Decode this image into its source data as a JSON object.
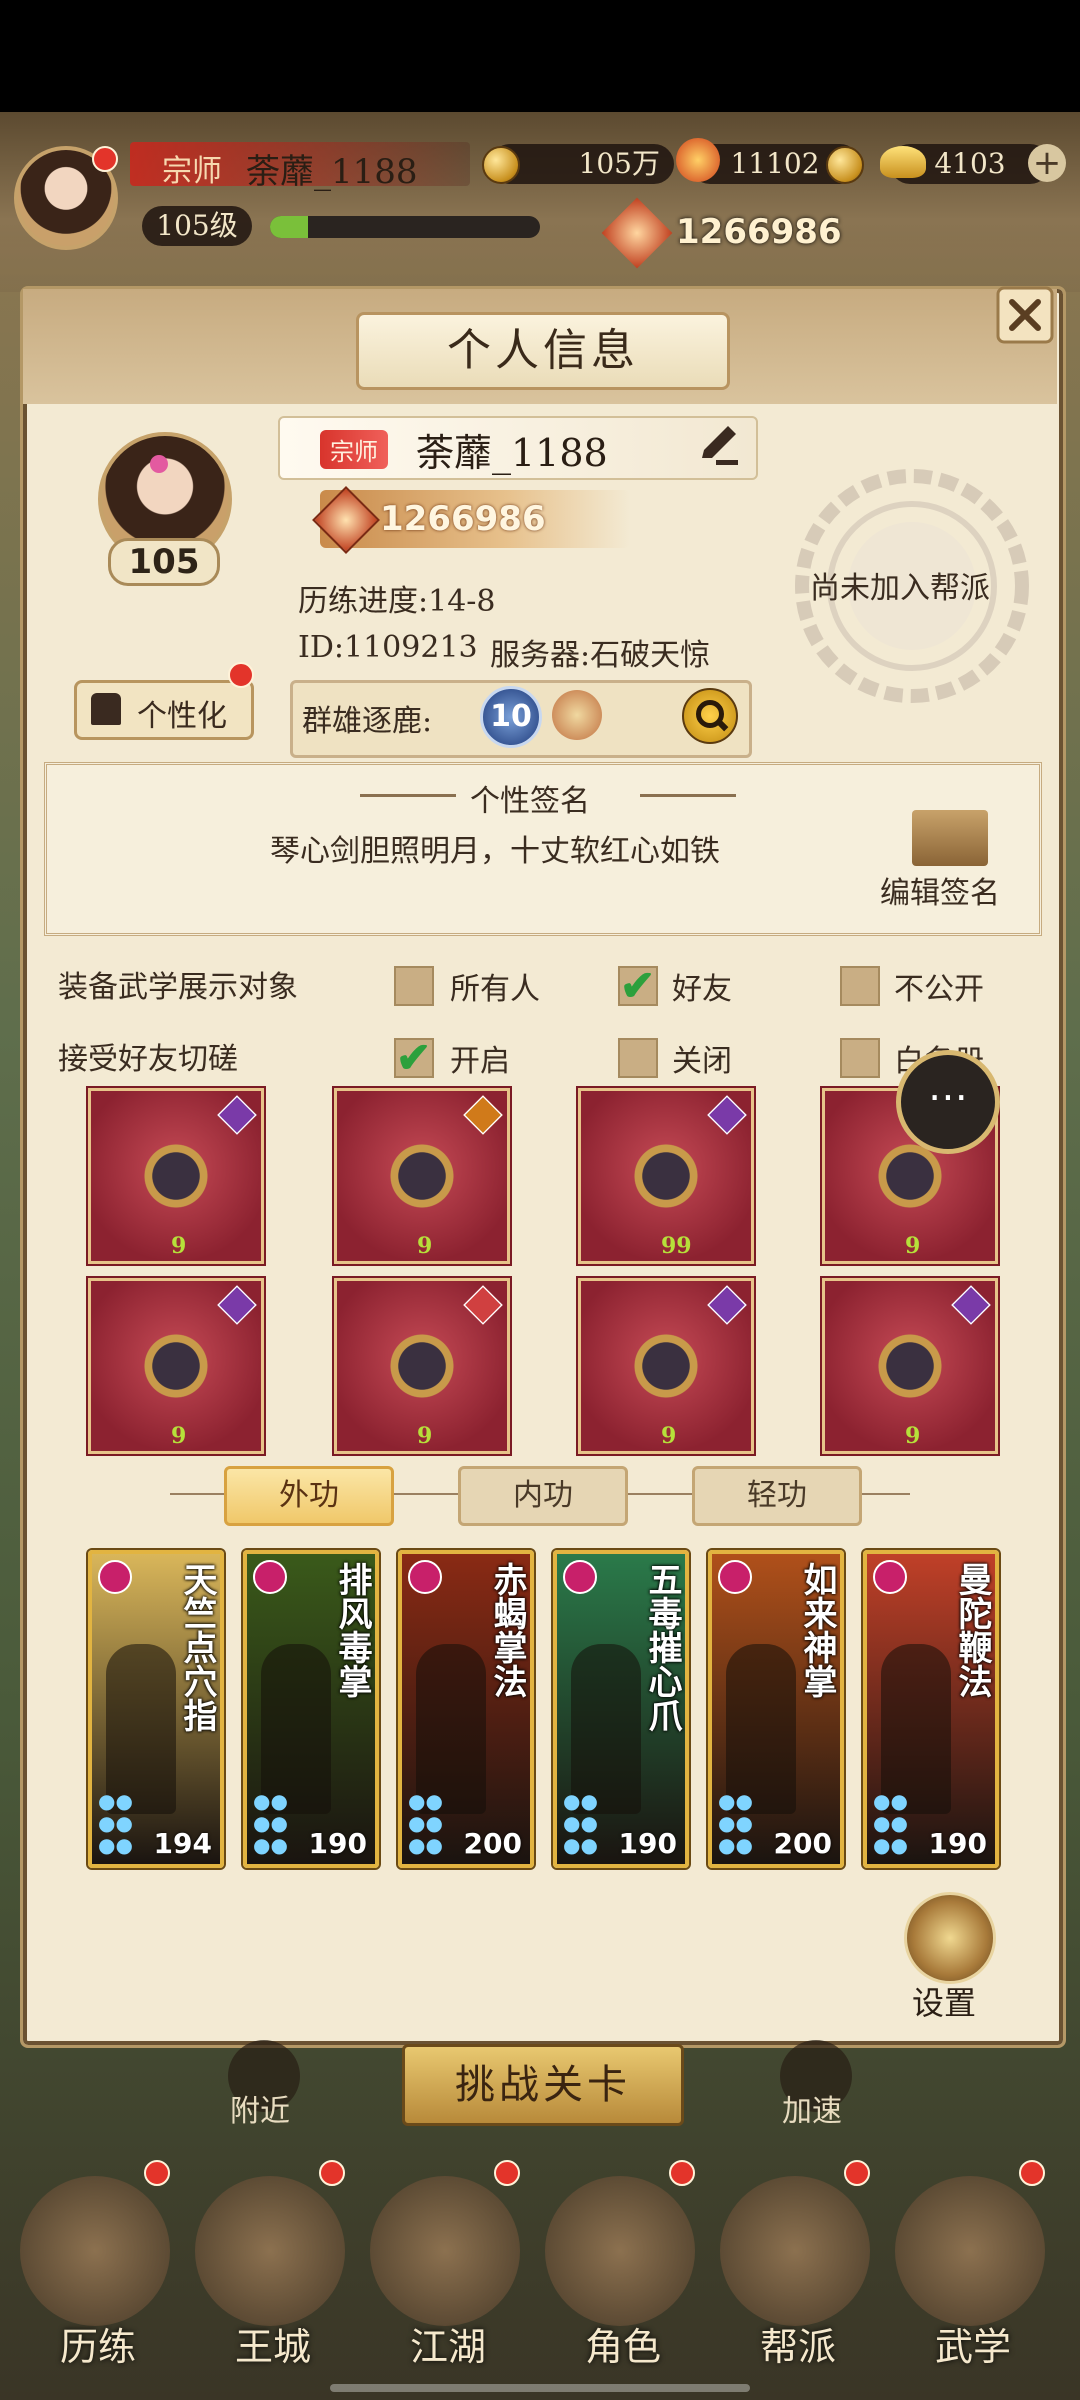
{
  "hud": {
    "title_badge": "宗师",
    "player_name": "荼蘼_1188",
    "level": "105级",
    "coins": "105万",
    "stamina": "11102",
    "ingots": "4103",
    "power": "1266986"
  },
  "panel": {
    "title": "个人信息",
    "badge": "宗师",
    "name": "荼蘼_1188",
    "power": "1266986",
    "level": "105",
    "progress": "历练进度:14-8",
    "id_line": "ID:1109213",
    "server": "服务器:石破天惊",
    "personalize": "个性化",
    "arena_label": "群雄逐鹿:",
    "arena_rank": "10",
    "guild_status": "尚未加入帮派",
    "signature_title": "个性签名",
    "signature_text": "琴心剑胆照明月，十丈软红心如铁",
    "edit_signature": "编辑签名"
  },
  "settings": {
    "equip_label": "装备武学展示对象",
    "equip_opts": [
      "所有人",
      "好友",
      "不公开"
    ],
    "equip_checked": 1,
    "spar_label": "接受好友切磋",
    "spar_opts": [
      "开启",
      "关闭",
      "白名册"
    ],
    "spar_checked": 0
  },
  "equipment": [
    {
      "name": "gauntlet",
      "lvl": "9",
      "color": "#7a3aa8"
    },
    {
      "name": "robe",
      "lvl": "9",
      "color": "#d07a1a"
    },
    {
      "name": "belt",
      "lvl": "99",
      "color": "#7a3aa8"
    },
    {
      "name": "boots",
      "lvl": "9",
      "color": "#7a3aa8"
    },
    {
      "name": "necklace",
      "lvl": "9",
      "color": "#7a3aa8"
    },
    {
      "name": "hairpin",
      "lvl": "9",
      "color": "#d04040"
    },
    {
      "name": "bracelet",
      "lvl": "9",
      "color": "#7a3aa8"
    },
    {
      "name": "ring",
      "lvl": "9",
      "color": "#7a3aa8"
    }
  ],
  "tabs": [
    "外功",
    "内功",
    "轻功"
  ],
  "active_tab": 0,
  "skills": [
    {
      "name": "天竺点穴指",
      "value": "194",
      "bg": "#d9b65a"
    },
    {
      "name": "排风毒掌",
      "value": "190",
      "bg": "#3a5a1a"
    },
    {
      "name": "赤蝎掌法",
      "value": "200",
      "bg": "#8a2a14"
    },
    {
      "name": "五毒摧心爪",
      "value": "190",
      "bg": "#2a7a4a"
    },
    {
      "name": "如来神掌",
      "value": "200",
      "bg": "#b0501a"
    },
    {
      "name": "曼陀鞭法",
      "value": "190",
      "bg": "#c04028"
    }
  ],
  "settings_btn": "设置",
  "behind": {
    "nearby": "附近",
    "challenge": "挑战关卡",
    "speedup": "加速"
  },
  "nav": [
    "历练",
    "王城",
    "江湖",
    "角色",
    "帮派",
    "武学"
  ]
}
